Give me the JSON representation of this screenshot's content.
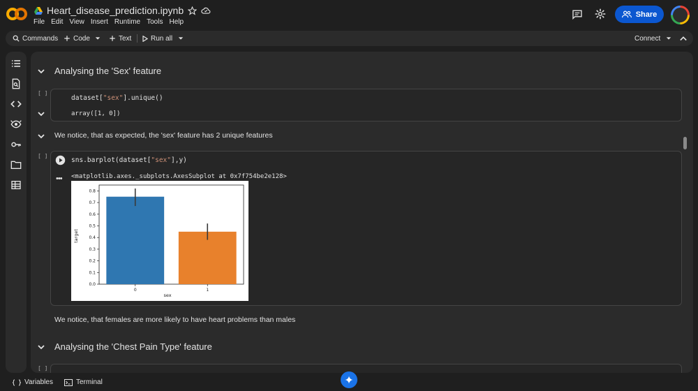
{
  "header": {
    "title": "Heart_disease_prediction.ipynb",
    "menu": [
      "File",
      "Edit",
      "View",
      "Insert",
      "Runtime",
      "Tools",
      "Help"
    ],
    "share_label": "Share"
  },
  "toolbar": {
    "commands_label": "Commands",
    "code_label": "Code",
    "text_label": "Text",
    "run_all_label": "Run all",
    "connect_label": "Connect"
  },
  "cells": {
    "heading_sex": "Analysing the 'Sex' feature",
    "code1_exec": "[ ]",
    "code1_prefix": "dataset[",
    "code1_string": "\"sex\"",
    "code1_suffix": "].unique()",
    "code1_output": "array([1, 0])",
    "md_unique": "We notice, that as expected, the 'sex' feature has 2 unique features",
    "code2_exec": "[ ]",
    "code2_prefix": "sns.barplot(dataset[",
    "code2_string": "\"sex\"",
    "code2_suffix": "],y)",
    "code2_output": "<matplotlib.axes._subplots.AxesSubplot at 0x7f754be2e128>",
    "md_conclusion": "We notice, that females are more likely to have heart problems than males",
    "heading_cp": "Analysing the 'Chest Pain Type' feature",
    "code3_exec": "[ ]"
  },
  "chart_data": {
    "type": "bar",
    "categories": [
      "0",
      "1"
    ],
    "values": [
      0.75,
      0.45
    ],
    "errors": [
      [
        0.67,
        0.82
      ],
      [
        0.38,
        0.52
      ]
    ],
    "colors": [
      "#2f77b1",
      "#e8812c"
    ],
    "xlabel": "sex",
    "ylabel": "target",
    "ylim": [
      0,
      0.85
    ],
    "yticks": [
      "0.0",
      "0.1",
      "0.2",
      "0.3",
      "0.4",
      "0.5",
      "0.6",
      "0.7",
      "0.8"
    ]
  },
  "bottombar": {
    "variables_label": "Variables",
    "terminal_label": "Terminal"
  },
  "colors": {
    "accent": "#0b57d0",
    "background": "#1f1f1f",
    "panel": "#2b2b2b",
    "colab_orange": "#f9ab00"
  },
  "icons": [
    "colab-logo-icon",
    "drive-icon",
    "star-icon",
    "cloud-icon",
    "comment-icon",
    "gear-icon",
    "share-people-icon",
    "search-icon",
    "plus-icon",
    "play-icon",
    "chevron-down-icon",
    "toc-icon",
    "find-icon",
    "code-icon",
    "secrets-icon",
    "key-icon",
    "folder-icon",
    "table-icon",
    "collapse-icon",
    "variables-icon",
    "terminal-icon",
    "gemini-icon"
  ]
}
